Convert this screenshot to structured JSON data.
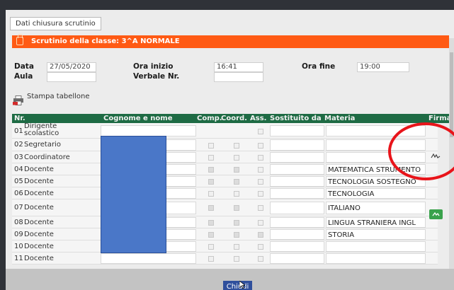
{
  "tab": {
    "label": "Dati chiusura scrutinio"
  },
  "header": {
    "title": "Scrutinio della classe: 3^A NORMALE",
    "icon": "lock-icon",
    "color": "#ff5a14"
  },
  "form": {
    "data_label": "Data",
    "data_value": "27/05/2020",
    "aula_label": "Aula",
    "aula_value": "",
    "ora_inizio_label": "Ora inizio",
    "ora_inizio_value": "16:41",
    "verbale_label": "Verbale Nr.",
    "verbale_value": "",
    "ora_fine_label": "Ora fine",
    "ora_fine_value": "19:00"
  },
  "print": {
    "label": "Stampa tabellone",
    "icon": "pdf-print-icon"
  },
  "table": {
    "header_color": "#1e6b44",
    "columns": {
      "nr": "Nr.",
      "name": "Cognome e nome",
      "comp": "Comp.",
      "coord": "Coord.",
      "ass": "Ass.",
      "sostituito": "Sostituito da",
      "materia": "Materia",
      "firma": "Firma"
    },
    "rows": [
      {
        "nr": "01",
        "role_line1": "Dirigente",
        "role_line2": "scolastico",
        "materia": ""
      },
      {
        "nr": "02",
        "role": "Segretario",
        "materia": ""
      },
      {
        "nr": "03",
        "role": "Coordinatore",
        "materia": ""
      },
      {
        "nr": "04",
        "role": "Docente",
        "materia": "MATEMATICA STRUMENTO"
      },
      {
        "nr": "05",
        "role": "Docente",
        "materia": "TECNOLOGIA SOSTEGNO"
      },
      {
        "nr": "06",
        "role": "Docente",
        "materia": "TECNOLOGIA"
      },
      {
        "nr": "07",
        "role": "Docente",
        "materia": "ITALIANO"
      },
      {
        "nr": "08",
        "role": "Docente",
        "materia": "LINGUA STRANIERA INGL"
      },
      {
        "nr": "09",
        "role": "Docente",
        "materia": "STORIA"
      },
      {
        "nr": "10",
        "role": "Docente",
        "materia": ""
      },
      {
        "nr": "11",
        "role": "Docente",
        "materia": ""
      }
    ]
  },
  "footer": {
    "close_label": "Chiudi"
  },
  "colors": {
    "close_button": "#2f4f9c",
    "annotation": "#e8141a",
    "sign_button": "#3aa24c",
    "redaction": "#4a77c8"
  }
}
